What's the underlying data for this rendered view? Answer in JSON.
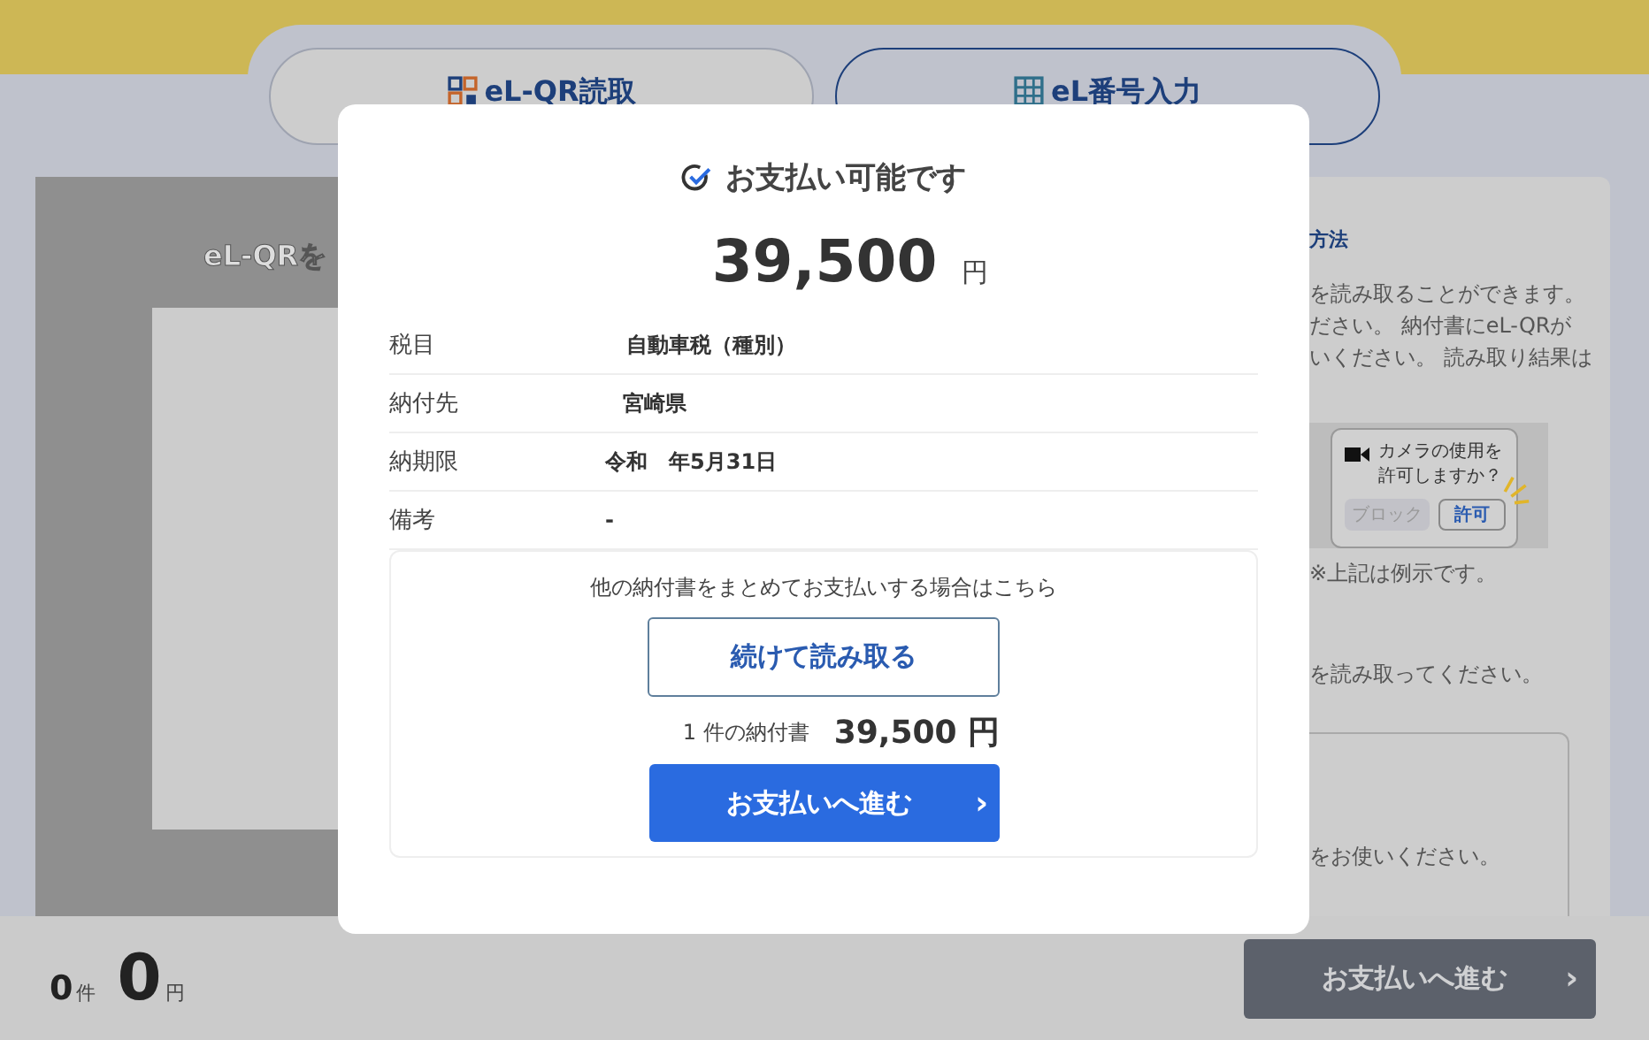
{
  "tabs": [
    {
      "label": "eL-QR読取",
      "selected": true
    },
    {
      "label": "eL番号入力",
      "selected": false
    }
  ],
  "reader": {
    "heading": "eL-QRを"
  },
  "guide": {
    "heading": "方法",
    "lines": [
      "を読み取ることができます。",
      "ださい。 納付書にeL-QRが",
      "いください。 読み取り結果は"
    ],
    "camera_prompt": {
      "text": "カメラの使用を許可しますか？",
      "block": "ブロック",
      "allow": "許可"
    },
    "note": "※上記は例示です。",
    "instruction": "を読み取ってください。",
    "box_text": "をお使いください。"
  },
  "footer": {
    "count": "0",
    "count_unit": "件",
    "total": "0",
    "total_unit": "円",
    "button": "お支払いへ進む",
    "button_chevron": "›",
    "disabled": true
  },
  "dialog": {
    "title": "お支払い可能です",
    "amount": "39,500",
    "amount_unit": "円",
    "rows": [
      {
        "label": "税目",
        "value": "自動車税（種別）"
      },
      {
        "label": "納付先",
        "value": "宮崎県"
      },
      {
        "label": "納期限",
        "value": "令和　年5月31日"
      },
      {
        "label": "備考",
        "value": "-"
      }
    ],
    "batch": {
      "prompt": "他の納付書をまとめてお支払いする場合はこちら",
      "continue_button": "続けて読み取る",
      "summary_label": "1 件の納付書",
      "summary_amount": "39,500 円",
      "pay_button": "お支払いへ進む",
      "pay_chevron": "›"
    }
  }
}
